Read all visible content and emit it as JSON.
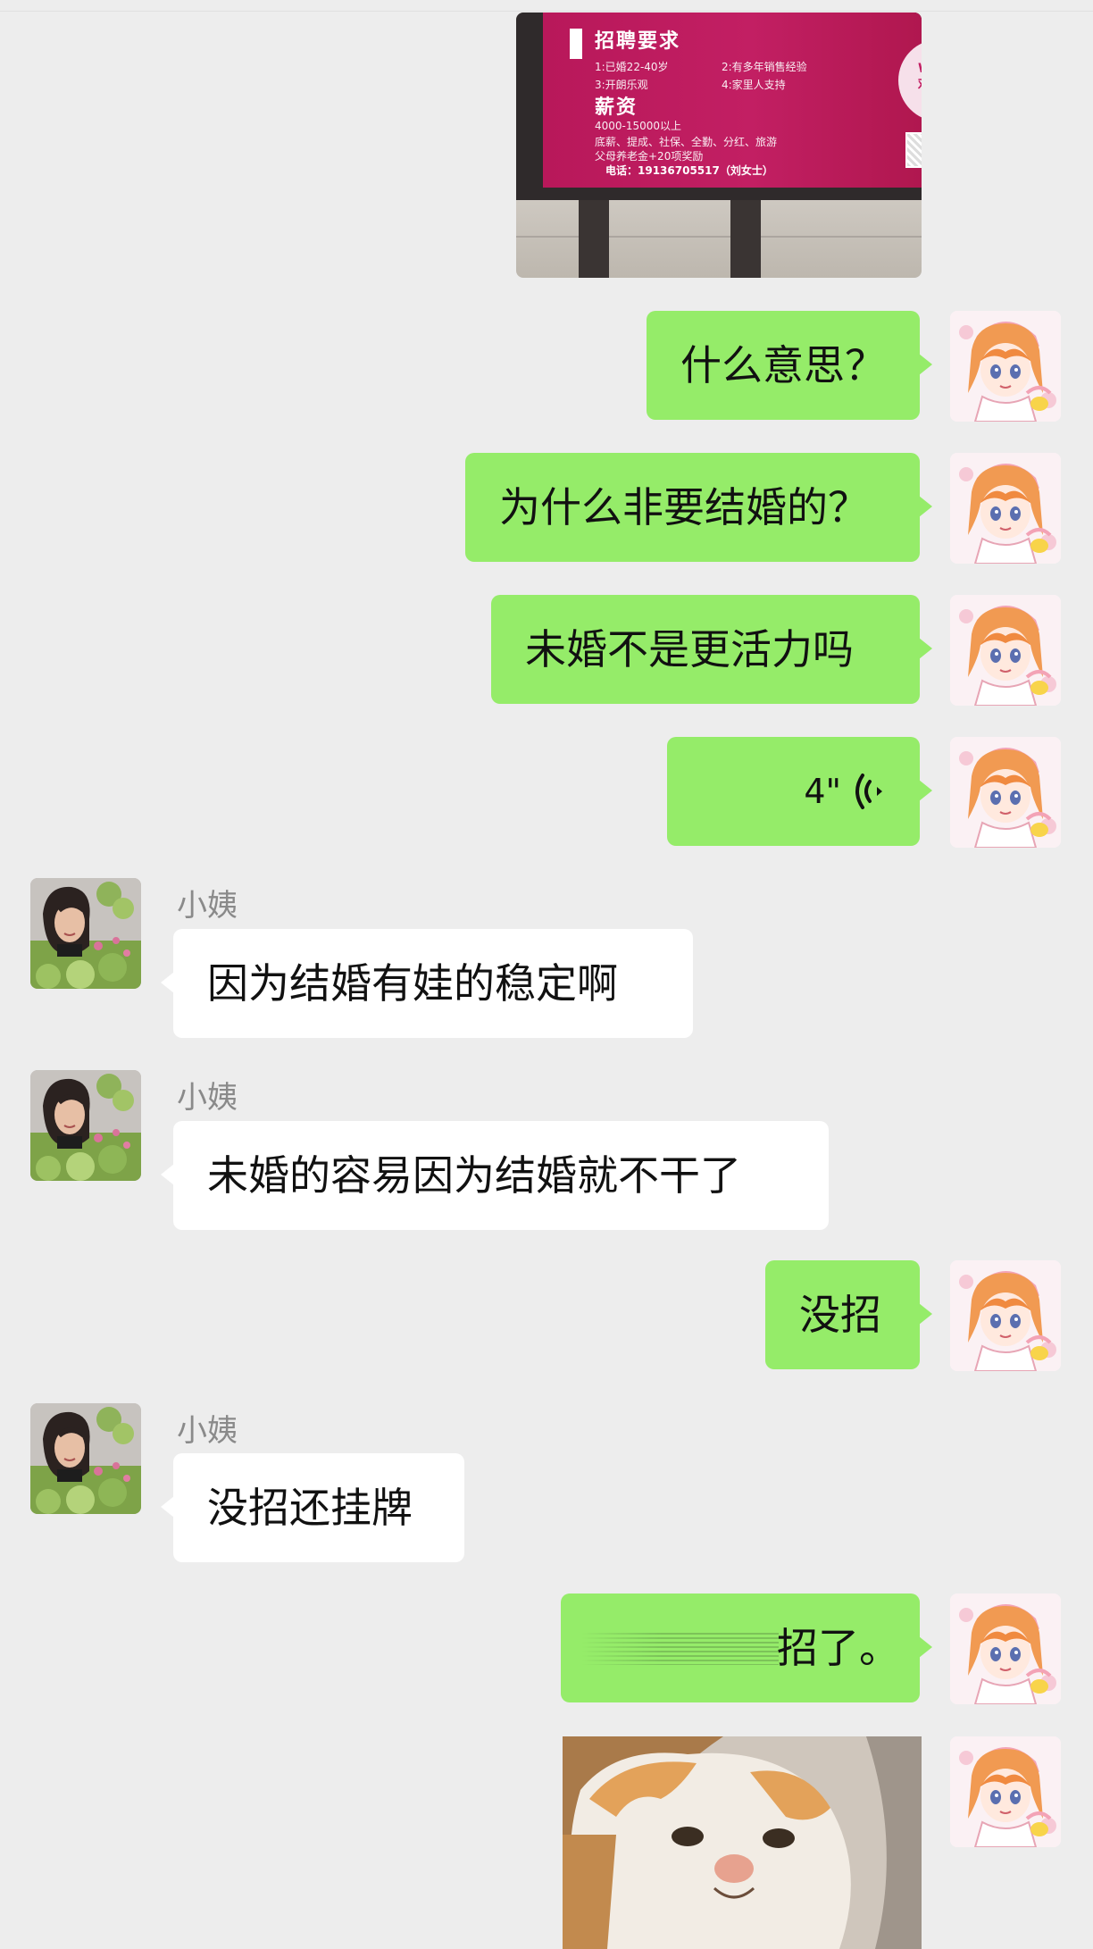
{
  "poster": {
    "title": "招聘要求",
    "req_1": "1:已婚22-40岁",
    "req_2": "2:有多年销售经验",
    "req_3": "3:开朗乐观",
    "req_4": "4:家里人支持",
    "salary_title": "薪资",
    "salary_range": "4000-15000以上",
    "benefits_1": "底薪、提成、社保、全勤、分红、旅游",
    "benefits_2": "父母养老金+20项奖励",
    "phone": "电话：19136705517（刘女士）",
    "logo_text": "WI 欢"
  },
  "messages": [
    {
      "from": "me",
      "type": "text",
      "text": "什么意思？"
    },
    {
      "from": "me",
      "type": "text",
      "text": "为什么非要结婚的？"
    },
    {
      "from": "me",
      "type": "text",
      "text": "未婚不是更活力吗"
    },
    {
      "from": "me",
      "type": "voice",
      "duration": "4\""
    },
    {
      "from": "them",
      "sender": "小姨",
      "type": "text",
      "text": "因为结婚有娃的稳定啊"
    },
    {
      "from": "them",
      "sender": "小姨",
      "type": "text",
      "text": "未婚的容易因为结婚就不干了"
    },
    {
      "from": "me",
      "type": "text",
      "text": "没招"
    },
    {
      "from": "them",
      "sender": "小姨",
      "type": "text",
      "text": "没招还挂牌"
    },
    {
      "from": "me",
      "type": "text",
      "text": "招了。"
    },
    {
      "from": "me",
      "type": "image",
      "image": "cat-photo"
    }
  ],
  "colors": {
    "background": "#ededed",
    "my_bubble": "#95ec69",
    "their_bubble": "#ffffff",
    "sender_name": "#8a8a8a"
  }
}
